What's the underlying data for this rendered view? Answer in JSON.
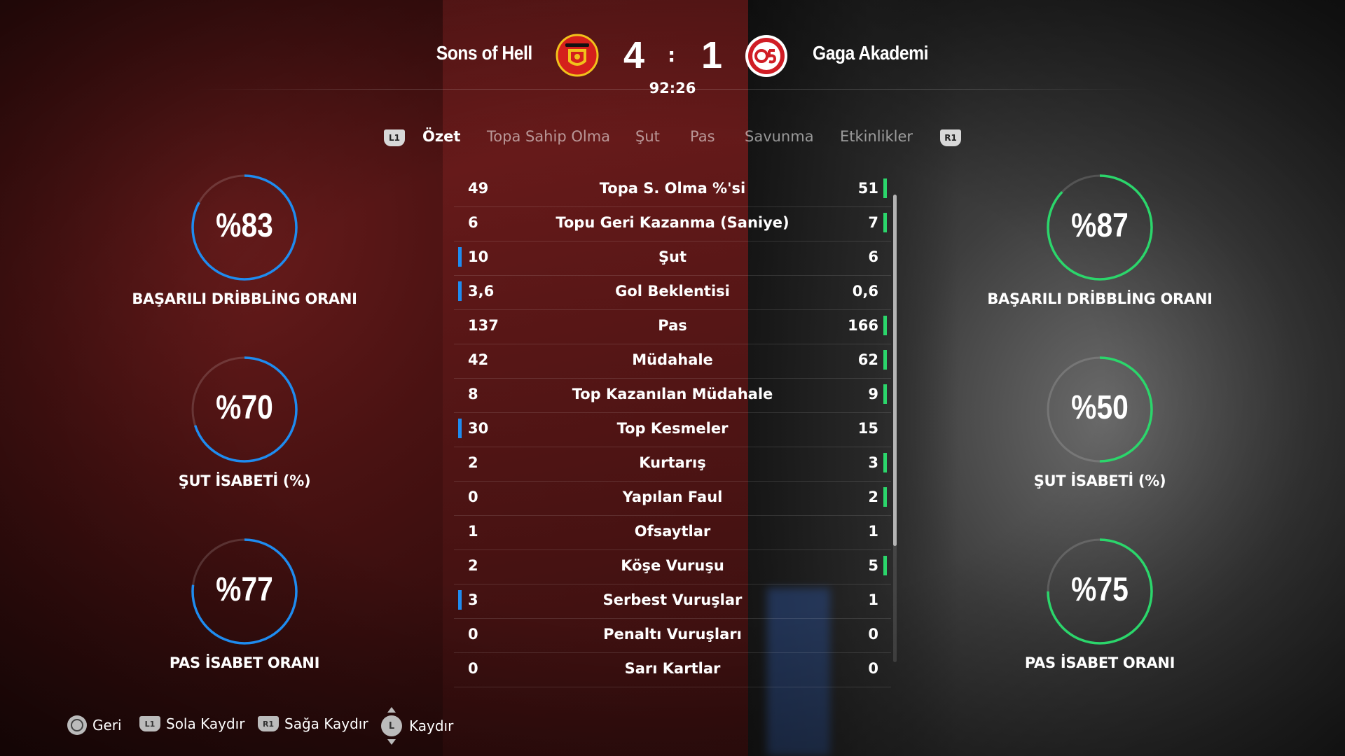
{
  "match": {
    "home_team": "Sons of Hell",
    "away_team": "Gaga Akademi",
    "home_score": "4",
    "away_score": "1",
    "separator": ":",
    "clock": "92:26",
    "home_crest_icon": "manchester-united-crest",
    "away_crest_icon": "mainz-05-crest"
  },
  "tabs": {
    "left_bumper": "L1",
    "right_bumper": "R1",
    "items": [
      {
        "label": "Özet",
        "active": true
      },
      {
        "label": "Topa Sahip Olma",
        "active": false
      },
      {
        "label": "Şut",
        "active": false
      },
      {
        "label": "Pas",
        "active": false
      },
      {
        "label": "Savunma",
        "active": false
      },
      {
        "label": "Etkinlikler",
        "active": false
      }
    ]
  },
  "stats": [
    {
      "name": "Topa S. Olma %'si",
      "home": "49",
      "away": "51",
      "leader": "away"
    },
    {
      "name": "Topu Geri Kazanma (Saniye)",
      "home": "6",
      "away": "7",
      "leader": "away"
    },
    {
      "name": "Şut",
      "home": "10",
      "away": "6",
      "leader": "home"
    },
    {
      "name": "Gol Beklentisi",
      "home": "3,6",
      "away": "0,6",
      "leader": "home"
    },
    {
      "name": "Pas",
      "home": "137",
      "away": "166",
      "leader": "away"
    },
    {
      "name": "Müdahale",
      "home": "42",
      "away": "62",
      "leader": "away"
    },
    {
      "name": "Top Kazanılan Müdahale",
      "home": "8",
      "away": "9",
      "leader": "away"
    },
    {
      "name": "Top Kesmeler",
      "home": "30",
      "away": "15",
      "leader": "home"
    },
    {
      "name": "Kurtarış",
      "home": "2",
      "away": "3",
      "leader": "away"
    },
    {
      "name": "Yapılan Faul",
      "home": "0",
      "away": "2",
      "leader": "away"
    },
    {
      "name": "Ofsaytlar",
      "home": "1",
      "away": "1",
      "leader": "none"
    },
    {
      "name": "Köşe Vuruşu",
      "home": "2",
      "away": "5",
      "leader": "away"
    },
    {
      "name": "Serbest Vuruşlar",
      "home": "3",
      "away": "1",
      "leader": "home"
    },
    {
      "name": "Penaltı Vuruşları",
      "home": "0",
      "away": "0",
      "leader": "none"
    },
    {
      "name": "Sarı Kartlar",
      "home": "0",
      "away": "0",
      "leader": "none"
    }
  ],
  "gauges": {
    "home": [
      {
        "value": "%83",
        "fraction": 0.83,
        "label": "BAŞARILI DRİBBLİNG ORANI"
      },
      {
        "value": "%70",
        "fraction": 0.7,
        "label": "ŞUT İSABETİ (%)"
      },
      {
        "value": "%77",
        "fraction": 0.77,
        "label": "PAS İSABET ORANI"
      }
    ],
    "away": [
      {
        "value": "%87",
        "fraction": 0.87,
        "label": "BAŞARILI DRİBBLİNG ORANI"
      },
      {
        "value": "%50",
        "fraction": 0.5,
        "label": "ŞUT İSABETİ (%)"
      },
      {
        "value": "%75",
        "fraction": 0.75,
        "label": "PAS İSABET ORANI"
      }
    ]
  },
  "footer": {
    "back": "Geri",
    "scroll_left_button": "L1",
    "scroll_left": "Sola Kaydır",
    "scroll_right_button": "R1",
    "scroll_right": "Sağa Kaydır",
    "stick_button": "L",
    "scroll": "Kaydır"
  },
  "colors": {
    "home_accent": "#1e8cf0",
    "away_accent": "#2bd66b"
  }
}
